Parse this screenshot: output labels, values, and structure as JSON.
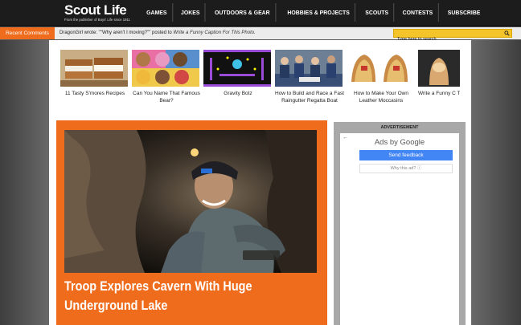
{
  "header": {
    "logo_title": "Scout Life",
    "logo_subtitle": "From the publisher of Boys' Life since 1911",
    "nav": [
      "GAMES",
      "JOKES",
      "OUTDOORS & GEAR",
      "HOBBIES & PROJECTS",
      "SCOUTS",
      "CONTESTS",
      "SUBSCRIBE"
    ]
  },
  "comments_bar": {
    "recent_label": "Recent Comments",
    "ticker_prefix": "DragonGirl wrote: \"\"Why aren't I moving?\"\" posted to ",
    "ticker_link": "Write a Funny Caption For This Photo.",
    "search_placeholder": "Type here to search"
  },
  "thumbnails": [
    {
      "caption": "11 Tasty S'mores Recipes"
    },
    {
      "caption": "Can You Name That Famous Bear?"
    },
    {
      "caption": "Gravity Botz"
    },
    {
      "caption": "How to Build and Race a Fast Raingutter Regatta Boat"
    },
    {
      "caption": "How to Make Your Own Leather Moccasins"
    },
    {
      "caption": "Write a Funny C This Pho"
    }
  ],
  "feature": {
    "title_line1": "Troop Explores Cavern With Huge",
    "title_line2": "Underground Lake"
  },
  "ad": {
    "label": "ADVERTISEMENT",
    "ads_by": "Ads by",
    "google": "Google",
    "feedback": "Send feedback",
    "why": "Why this ad?"
  },
  "colors": {
    "accent_orange": "#ef6c1d",
    "search_yellow": "#f5c42a",
    "feedback_blue": "#4285f4"
  }
}
